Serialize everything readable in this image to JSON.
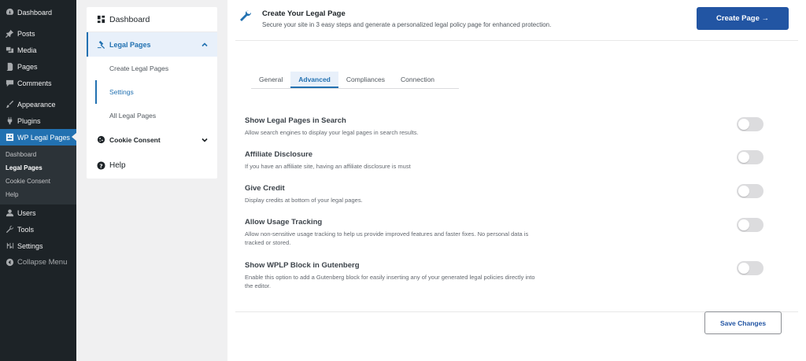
{
  "wp_menu": {
    "items": [
      {
        "label": "Dashboard",
        "icon": "dashboard-icon"
      },
      {
        "label": "Posts",
        "icon": "pin-icon"
      },
      {
        "label": "Media",
        "icon": "media-icon"
      },
      {
        "label": "Pages",
        "icon": "page-icon"
      },
      {
        "label": "Comments",
        "icon": "comment-icon"
      },
      {
        "label": "Appearance",
        "icon": "brush-icon"
      },
      {
        "label": "Plugins",
        "icon": "plugin-icon"
      },
      {
        "label": "WP Legal Pages",
        "icon": "wplp-logo-icon"
      },
      {
        "label": "Users",
        "icon": "users-icon"
      },
      {
        "label": "Tools",
        "icon": "wrench-icon"
      },
      {
        "label": "Settings",
        "icon": "settings-icon"
      },
      {
        "label": "Collapse Menu",
        "icon": "collapse-icon"
      }
    ],
    "submenu": [
      "Dashboard",
      "Legal Pages",
      "Cookie Consent",
      "Help"
    ],
    "accent": "#2271b1"
  },
  "plugin_menu": {
    "dashboard": "Dashboard",
    "legal_pages": "Legal Pages",
    "sub": [
      "Create Legal Pages",
      "Settings",
      "All Legal Pages"
    ],
    "cookie_consent": "Cookie Consent",
    "help": "Help"
  },
  "banner": {
    "title": "Create Your Legal Page",
    "description": "Secure your site in 3 easy steps and generate a personalized legal policy page for enhanced protection.",
    "create_button": "Create Page →",
    "button_color": "#2255a3"
  },
  "tabs": [
    "General",
    "Advanced",
    "Compliances",
    "Connection"
  ],
  "settings": [
    {
      "title": "Show Legal Pages in Search",
      "description": "Allow search engines to display your legal pages in search results.",
      "enabled": false
    },
    {
      "title": "Affiliate Disclosure",
      "description": "If you have an affiliate site, having an affiliate disclosure is must",
      "enabled": false
    },
    {
      "title": "Give Credit",
      "description": "Display credits at bottom of your legal pages.",
      "enabled": false
    },
    {
      "title": "Allow Usage Tracking",
      "description": "Allow non-sensitive usage tracking to help us provide improved features and faster fixes. No personal data is tracked or stored.",
      "enabled": false
    },
    {
      "title": "Show WPLP Block in Gutenberg",
      "description": "Enable this option to add a Gutenberg block for easily inserting any of your generated legal policies directly into the editor.",
      "enabled": false
    }
  ],
  "save_button": "Save Changes"
}
